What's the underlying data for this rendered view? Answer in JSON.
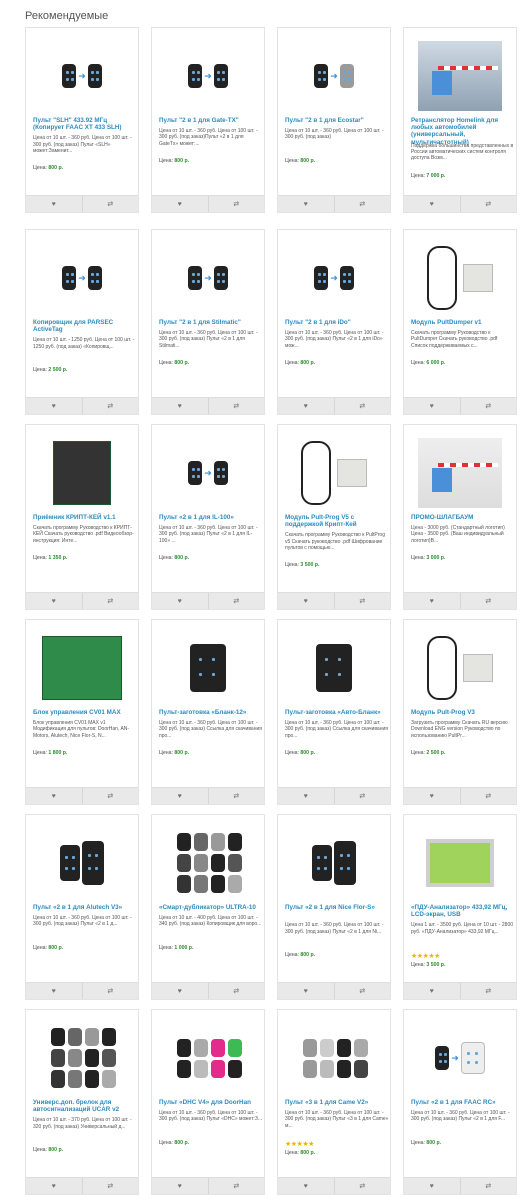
{
  "heading": "Рекомендуемые",
  "btn_icons": {
    "wishlist": "heart-icon",
    "compare": "compare-icon"
  },
  "colors": {
    "title": "#2a8bbf",
    "price": "#2e8b2e",
    "stars": "#f0b400"
  },
  "products": [
    {
      "title": "Пульт \"SLH\" 433.92 МГц (Копирует FAAC XT 433 SLH)",
      "desc": "Цена от 10 шт. - 360 руб. Цена от 100 шт. - 300 руб. (под заказ) Пульт «SLH» может:Заменит...",
      "price_label": "Цена:",
      "price": "800 р.",
      "image": "remotes-slh",
      "stars": 0
    },
    {
      "title": "Пульт \"2 в 1 для Gate-TX\"",
      "desc": "Цена от 10 шт. - 360 руб. Цена от 100 шт. - 300 руб. (под заказ)Пульт «2 в 1 для GateTx» может:...",
      "price_label": "Цена:",
      "price": "800 р.",
      "image": "remotes-gatetx",
      "stars": 0
    },
    {
      "title": "Пульт \"2 в 1 для Ecostar\"",
      "desc": "Цена от 10 шт. - 360 руб. Цена от 100 шт. - 300 руб. (под заказ)",
      "price_label": "Цена:",
      "price": "800 р.",
      "image": "remotes-ecostar",
      "stars": 0
    },
    {
      "title": "Ретранслятор Homelink для любых автомобилей (универсальный, мультичастотный)",
      "desc": "Поддержка большинства представленных в России автоматических систем контроля доступа Возм...",
      "price_label": "Цена:",
      "price": "7 000 р.",
      "image": "homelink-device",
      "stars": 0
    },
    {
      "title": "Копировщик для PARSEC ActiveTag",
      "desc": "Цена от 10 шт. - 1250 руб. Цена от 100 шт. - 1250 руб. (под заказ) «Копировщ...",
      "price_label": "Цена:",
      "price": "2 500 р.",
      "image": "parsec-copier",
      "stars": 0
    },
    {
      "title": "Пульт \"2 в 1 для Stilmatic\"",
      "desc": "Цена от 10 шт. - 360 руб. Цена от 100 шт. - 300 руб. (под заказ) Пульт «2 в 1 для Stilmati...",
      "price_label": "Цена:",
      "price": "800 р.",
      "image": "remotes-stilmatic",
      "stars": 0
    },
    {
      "title": "Пульт \"2 в 1 для iDo\"",
      "desc": "Цена от 10 шт. - 360 руб. Цена от 100 шт. - 300 руб. (под заказ) Пульт «2 в 1 для iDo» мож...",
      "price_label": "Цена:",
      "price": "800 р.",
      "image": "remotes-ido",
      "stars": 0
    },
    {
      "title": "Модуль PultDumper v1",
      "desc": "Скачать программу Руководство к PultDumper Скачать руководство .pdf Список поддерживаемых с...",
      "price_label": "Цена:",
      "price": "6 000 р.",
      "image": "pultdumper-module",
      "stars": 0
    },
    {
      "title": "Приёмник КРИПТ-КЕЙ v1.1",
      "desc": "Скачать программу Руководство к КРИПТ-КЕЙ Скачать руководство .pdf Видеообзор-инструкция: Инте...",
      "price_label": "Цена:",
      "price": "1 350 р.",
      "image": "receiver-kriptkey",
      "stars": 0
    },
    {
      "title": "Пульт «2 в 1 для IL-100»",
      "desc": "Цена от 10 шт. - 360 руб. Цена от 100 шт. - 300 руб. (под заказ) Пульт «2 в 1 для IL-100» ...",
      "price_label": "Цена:",
      "price": "800 р.",
      "image": "remotes-il100",
      "stars": 0
    },
    {
      "title": "Модуль Pult-Prog V5 с поддержкой Крипт-Кей",
      "desc": "Скачать программу Руководство к PultProg v5 Скачать руководство .pdf Шифрование пультов с помощью...",
      "price_label": "Цена:",
      "price": "3 500 р.",
      "image": "pultprog-v5",
      "stars": 0
    },
    {
      "title": "ПРОМО-ШЛАГБАУМ",
      "desc": "Цена - 3000 руб. (Стандартный логотип) Цена - 3500 руб. (Ваш индивидуальный логотип)В...",
      "price_label": "Цена:",
      "price": "3 000 р.",
      "image": "promo-barrier",
      "stars": 0
    },
    {
      "title": "Блок управления CV01 MAX",
      "desc": "Блок управления CV01 MAX v1 Модификация для пультов: DoorHan, AN-Motors, Alutech, Nice Flor-S, N...",
      "price_label": "Цена:",
      "price": "1 800 р.",
      "image": "control-board",
      "stars": 0
    },
    {
      "title": "Пульт-заготовка «Бланк-12»",
      "desc": "Цена от 10 шт. - 360 руб. Цена от 100 шт. - 300 руб. (под заказ) Ссылка для скачивания про...",
      "price_label": "Цена:",
      "price": "800 р.",
      "image": "remote-blank12",
      "stars": 0
    },
    {
      "title": "Пульт-заготовка «Авто-Бланк»",
      "desc": "Цена от 10 шт. - 360 руб. Цена от 100 шт. - 300 руб. (под заказ) Ссылка для скачивания про...",
      "price_label": "Цена:",
      "price": "800 р.",
      "image": "remote-autoblank",
      "stars": 0
    },
    {
      "title": "Модуль Pult-Prog V3",
      "desc": "Загрузить программу Скачать RU версию Download ENG version Руководство по использованию PultPr...",
      "price_label": "Цена:",
      "price": "2 500 р.",
      "image": "pultprog-v3",
      "stars": 0
    },
    {
      "title": "Пульт «2 в 1 для Alutech V3»",
      "desc": "Цена от 10 шт. - 360 руб. Цена от 100 шт. - 300 руб. (под заказ) Пульт «2 в 1 д...",
      "price_label": "Цена:",
      "price": "800 р.",
      "image": "remotes-alutech",
      "stars": 0
    },
    {
      "title": "«Смарт-дубликатор» ULTRA-10",
      "desc": "Цена от 10 шт. - 400 руб. Цена от 100 шт. - 340 руб. (под заказ) Копировщик для воро...",
      "price_label": "Цена:",
      "price": "1 000 р.",
      "image": "smart-duplicator",
      "stars": 0
    },
    {
      "title": "Пульт «2 в 1 для Nice Flor-S»",
      "desc": "Цена от 10 шт. - 360 руб. Цена от 100 шт. - 300 руб. (под заказ) Пульт «2 в 1 для Ni...",
      "price_label": "Цена:",
      "price": "800 р.",
      "image": "remotes-nice",
      "stars": 0
    },
    {
      "title": "«ПДУ-Анализатор» 433,92 МГц, LCD-экран, USB",
      "desc": "Цена 1 шт. - 3500 руб. Цена от 10 шт. - 2800 руб. «ПДУ-Анализатор» 433,92 МГц...",
      "price_label": "Цена:",
      "price": "3 500 р.",
      "image": "analyzer-lcd",
      "stars": 5
    },
    {
      "title": "Универс.доп. брелок для автосигнализаций UCAR v2",
      "desc": "Цена от 10 шт. - 370 руб. Цена от 100 шт. - 320 руб. (под заказ) Универсальный д...",
      "price_label": "Цена:",
      "price": "800 р.",
      "image": "ucar-keyfobs",
      "stars": 0
    },
    {
      "title": "Пульт «DHC V4» для DoorHan",
      "desc": "Цена от 10 шт. - 360 руб. Цена от 100 шт. - 300 руб. (под заказ) Пульт «DHC» может:З...",
      "price_label": "Цена:",
      "price": "800 р.",
      "image": "remotes-dhc",
      "stars": 0
    },
    {
      "title": "Пульт «3 в 1 для Came V2»",
      "desc": "Цена от 10 шт. - 360 руб. Цена от 100 шт. - 300 руб. (под заказ) Пульт «3 в 1 для Came» м...",
      "price_label": "Цена:",
      "price": "800 р.",
      "image": "remotes-came",
      "stars": 5
    },
    {
      "title": "Пульт «2 в 1 для FAAC RC»",
      "desc": "Цена от 10 шт. - 360 руб. Цена от 100 шт. - 300 руб. (под заказ) Пульт «2 в 1 для F...",
      "price_label": "Цена:",
      "price": "800 р.",
      "image": "remotes-faac",
      "stars": 0
    }
  ]
}
